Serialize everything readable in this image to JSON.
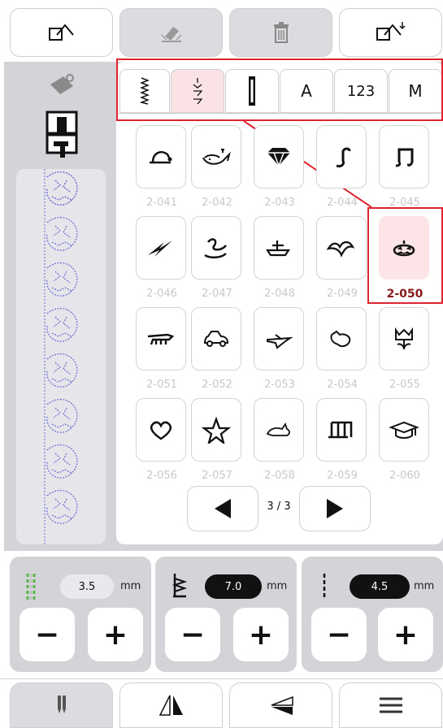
{
  "toolbar": {
    "buttons": [
      {
        "icon": "export-icon",
        "enabled": true
      },
      {
        "icon": "eraser-icon",
        "enabled": false
      },
      {
        "icon": "trash-icon",
        "enabled": false
      },
      {
        "icon": "import-icon",
        "enabled": true
      }
    ]
  },
  "tabs": [
    {
      "label": "",
      "icon": "utility-stitch-icon"
    },
    {
      "label": "",
      "icon": "decorative-stitch-icon",
      "active": true
    },
    {
      "label": "",
      "icon": "buttonhole-icon"
    },
    {
      "label": "A"
    },
    {
      "label": "123"
    },
    {
      "label": "M"
    }
  ],
  "patterns": [
    {
      "code": "2-041",
      "icon": "hat-icon"
    },
    {
      "code": "2-042",
      "icon": "whale-icon"
    },
    {
      "code": "2-043",
      "icon": "diamond-icon"
    },
    {
      "code": "2-044",
      "icon": "music-note-icon"
    },
    {
      "code": "2-045",
      "icon": "double-note-icon"
    },
    {
      "code": "2-046",
      "icon": "lightning-icon"
    },
    {
      "code": "2-047",
      "icon": "swan-icon"
    },
    {
      "code": "2-048",
      "icon": "boat-icon"
    },
    {
      "code": "2-049",
      "icon": "bat-icon"
    },
    {
      "code": "2-050",
      "icon": "pumpkin-icon",
      "selected": true
    },
    {
      "code": "2-051",
      "icon": "dinosaur-icon"
    },
    {
      "code": "2-052",
      "icon": "car-icon"
    },
    {
      "code": "2-053",
      "icon": "airplane-icon"
    },
    {
      "code": "2-054",
      "icon": "cat-icon"
    },
    {
      "code": "2-055",
      "icon": "tulip-icon"
    },
    {
      "code": "2-056",
      "icon": "heart-icon"
    },
    {
      "code": "2-057",
      "icon": "star-icon"
    },
    {
      "code": "2-058",
      "icon": "rabbit-icon"
    },
    {
      "code": "2-059",
      "icon": "triple-note-icon"
    },
    {
      "code": "2-060",
      "icon": "graduation-cap-icon"
    }
  ],
  "pager": {
    "label": "3 / 3"
  },
  "settings": {
    "width": {
      "value": "3.5",
      "unit": "mm",
      "icon": "stitch-width-icon"
    },
    "length": {
      "value": "7.0",
      "unit": "mm",
      "icon": "stitch-length-icon"
    },
    "tension": {
      "value": "4.5",
      "unit": "mm",
      "icon": "tension-icon"
    }
  },
  "bottom_bar": {
    "buttons": [
      {
        "icon": "needle-position-icon",
        "active": true
      },
      {
        "icon": "mirror-vertical-icon"
      },
      {
        "icon": "mirror-horizontal-icon"
      },
      {
        "icon": "menu-icon"
      }
    ]
  },
  "colors": {
    "accent": "#e0242f",
    "selected_bg": "#fde4e6",
    "panel": "#d3d3d8"
  }
}
